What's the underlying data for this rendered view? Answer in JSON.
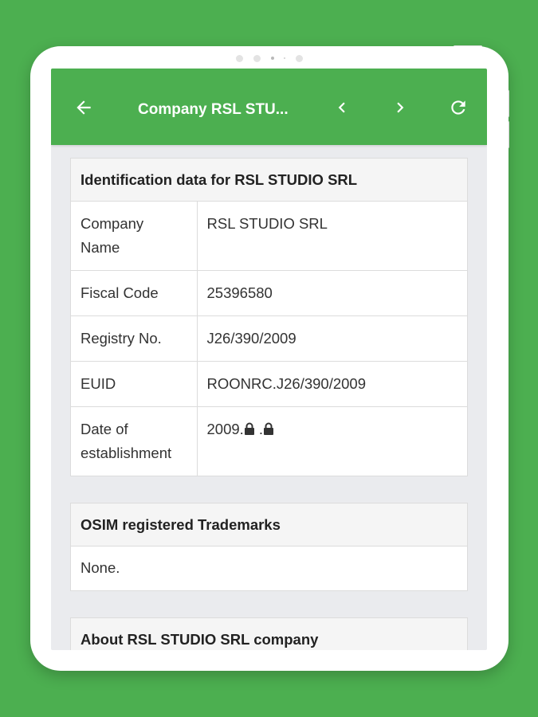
{
  "appbar": {
    "title": "Company RSL STU...",
    "icons": [
      "arrow-left-icon",
      "chevron-left-icon",
      "chevron-right-icon",
      "refresh-icon"
    ]
  },
  "identification": {
    "header": "Identification data for RSL STUDIO SRL",
    "rows": [
      {
        "label": "Company Name",
        "value": "RSL STUDIO SRL"
      },
      {
        "label": "Fiscal Code",
        "value": "25396580"
      },
      {
        "label": "Registry No.",
        "value": "J26/390/2009"
      },
      {
        "label": "EUID",
        "value": "ROONRC.J26/390/2009"
      },
      {
        "label": "Date of establishment",
        "value_prefix": "2009.",
        "value_sep": " .",
        "value_icon": "lock-icon"
      }
    ]
  },
  "trademarks": {
    "header": "OSIM registered Trademarks",
    "value": "None."
  },
  "about": {
    "header": "About RSL STUDIO SRL company"
  },
  "colors": {
    "brand": "#4caf50",
    "surface": "#eaebee"
  }
}
